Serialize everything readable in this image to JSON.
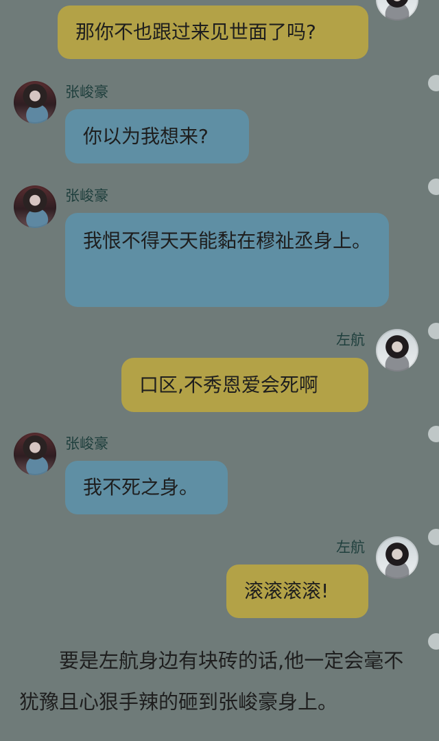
{
  "messages": [
    {
      "sender": "",
      "side": "right",
      "text": "那你不也跟过来见世面了吗?"
    },
    {
      "sender": "张峻豪",
      "side": "left",
      "text": "你以为我想来?"
    },
    {
      "sender": "张峻豪",
      "side": "left",
      "text": "我恨不得天天能黏在穆祉丞身上。"
    },
    {
      "sender": "左航",
      "side": "right",
      "text": "口区,不秀恩爱会死啊"
    },
    {
      "sender": "张峻豪",
      "side": "left",
      "text": "我不死之身。"
    },
    {
      "sender": "左航",
      "side": "right",
      "text": "滚滚滚滚!"
    }
  ],
  "narration": "要是左航身边有块砖的话,他一定会毫不犹豫且心狠手辣的砸到张峻豪身上。",
  "colors": {
    "background": "#6f7b79",
    "left_bubble": "#5f8fa4",
    "right_bubble": "#b3a247",
    "name_text": "#1f3f3d"
  }
}
